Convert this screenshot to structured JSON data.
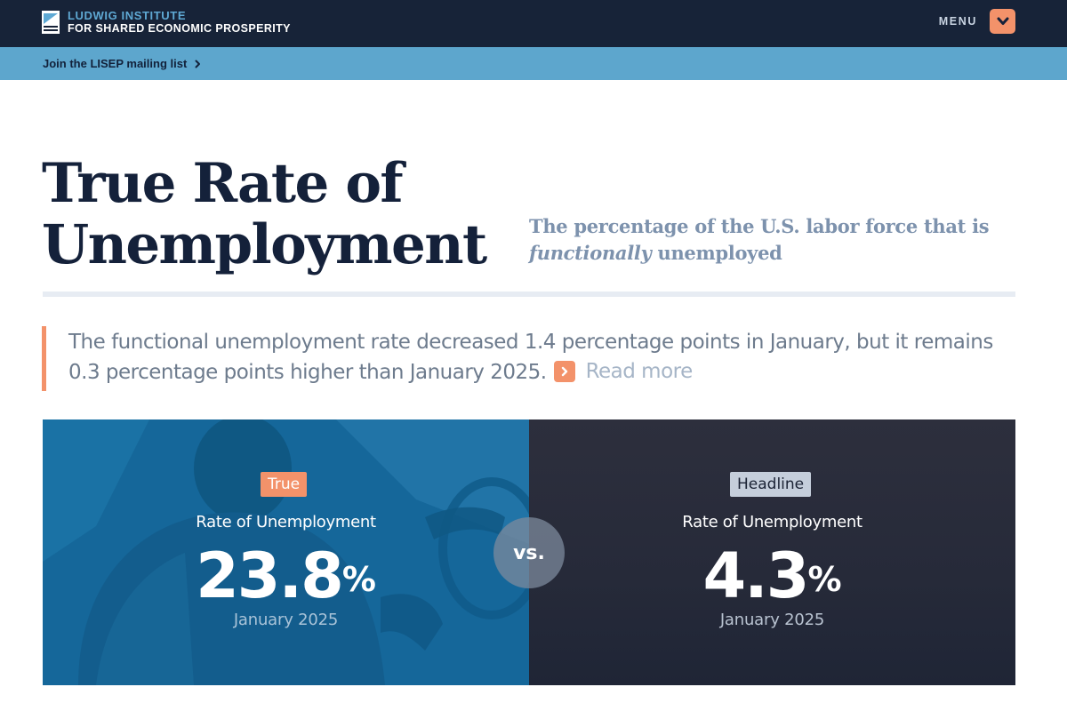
{
  "header": {
    "logo_line1": "LUDWIG INSTITUTE",
    "logo_line2": "FOR SHARED ECONOMIC PROSPERITY",
    "menu_label": "MENU",
    "menu_icon": "chevron-down-icon"
  },
  "mailing": {
    "link_text": "Join the LISEP mailing list",
    "icon": "chevron-right-icon"
  },
  "page": {
    "title_line1": "True Rate of",
    "title_line2": "Unemployment",
    "subtitle_part1": "The percentage of the U.S. labor force that is ",
    "subtitle_emphasis": "functionally",
    "subtitle_part2": " unemployed"
  },
  "summary": {
    "text": "The functional unemployment rate decreased 1.4 percentage points in January, but it remains 0.3 percentage points higher than January 2025.",
    "read_more": "Read more"
  },
  "comparison": {
    "true_rate": {
      "badge": "True",
      "label": "Rate of Unemployment",
      "value": "23.8",
      "unit": "%",
      "date": "January 2025"
    },
    "vs": "vs.",
    "headline_rate": {
      "badge": "Headline",
      "label": "Rate of Unemployment",
      "value": "4.3",
      "unit": "%",
      "date": "January 2025"
    }
  },
  "colors": {
    "navy": "#172338",
    "sky": "#5da6cd",
    "accent_orange": "#f3926a",
    "true_panel_blue": "#13679b",
    "headline_panel_dark": "#262a39",
    "subtitle_gray_blue": "#7d92ad"
  }
}
